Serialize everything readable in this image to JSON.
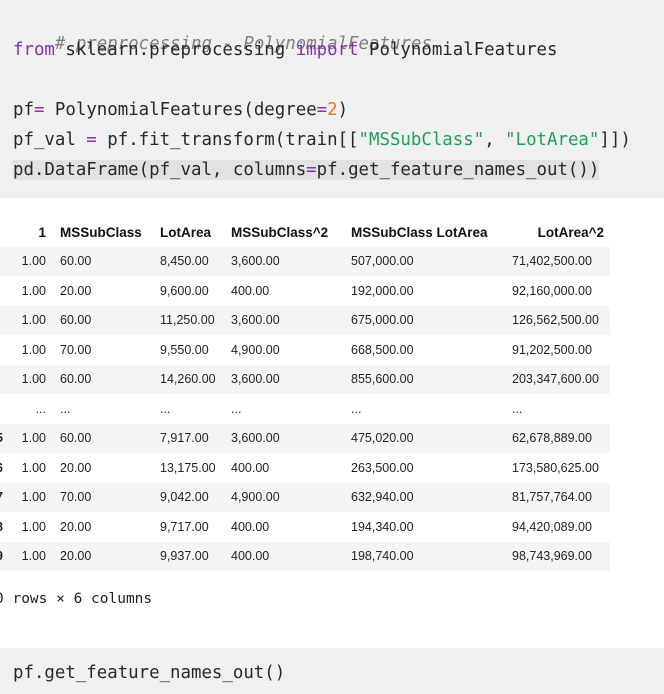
{
  "cell1": {
    "comment": "# preprocessing - PolynomialFeatures",
    "import_from": "from",
    "import_module": " sklearn.preprocessing ",
    "import_kw": "import",
    "import_name": " PolynomialFeatures",
    "pf_var": "pf",
    "pf_eq": "=",
    "pf_call": " PolynomialFeatures(degree",
    "pf_eq2": "=",
    "pf_degree": "2",
    "pf_close": ")",
    "val_var": "pf_val ",
    "val_eq": "=",
    "val_call": " pf.fit_transform(train[[",
    "val_str1": "\"MSSubClass\"",
    "val_comma": ", ",
    "val_str2": "\"LotArea\"",
    "val_close": "]])",
    "df_call": "pd.DataFrame(pf_val, columns",
    "df_eq": "=",
    "df_rest": "pf.get_feature_names_out())"
  },
  "table": {
    "headers": [
      "1",
      "MSSubClass",
      "LotArea",
      "MSSubClass^2",
      "MSSubClass LotArea",
      "LotArea^2"
    ],
    "rows": [
      {
        "idx": "",
        "cells": [
          "1.00",
          "60.00",
          "8,450.00",
          "3,600.00",
          "507,000.00",
          "71,402,500.00"
        ]
      },
      {
        "idx": "",
        "cells": [
          "1.00",
          "20.00",
          "9,600.00",
          "400.00",
          "192,000.00",
          "92,160,000.00"
        ]
      },
      {
        "idx": "",
        "cells": [
          "1.00",
          "60.00",
          "11,250.00",
          "3,600.00",
          "675,000.00",
          "126,562,500.00"
        ]
      },
      {
        "idx": "",
        "cells": [
          "1.00",
          "70.00",
          "9,550.00",
          "4,900.00",
          "668,500.00",
          "91,202,500.00"
        ]
      },
      {
        "idx": "",
        "cells": [
          "1.00",
          "60.00",
          "14,260.00",
          "3,600.00",
          "855,600.00",
          "203,347,600.00"
        ]
      },
      {
        "idx": "",
        "cells": [
          "...",
          "...",
          "...",
          "...",
          "...",
          "..."
        ]
      },
      {
        "idx": "5",
        "cells": [
          "1.00",
          "60.00",
          "7,917.00",
          "3,600.00",
          "475,020.00",
          "62,678,889.00"
        ]
      },
      {
        "idx": "6",
        "cells": [
          "1.00",
          "20.00",
          "13,175.00",
          "400.00",
          "263,500.00",
          "173,580,625.00"
        ]
      },
      {
        "idx": "7",
        "cells": [
          "1.00",
          "70.00",
          "9,042.00",
          "4,900.00",
          "632,940.00",
          "81,757,764.00"
        ]
      },
      {
        "idx": "8",
        "cells": [
          "1.00",
          "20.00",
          "9,717.00",
          "400.00",
          "194,340.00",
          "94,420,089.00"
        ]
      },
      {
        "idx": "9",
        "cells": [
          "1.00",
          "20.00",
          "9,937.00",
          "400.00",
          "198,740.00",
          "98,743,969.00"
        ]
      }
    ],
    "summary": "0 rows × 6 columns"
  },
  "cell2": {
    "code": "pf.get_feature_names_out()"
  },
  "colors": {
    "cell_bg": "#f0f0f0",
    "keyword": "#8b2fb3",
    "number": "#e07a19",
    "string": "#20a05a",
    "comment": "#7f7f7f",
    "row_stripe": "#f5f5f5"
  }
}
